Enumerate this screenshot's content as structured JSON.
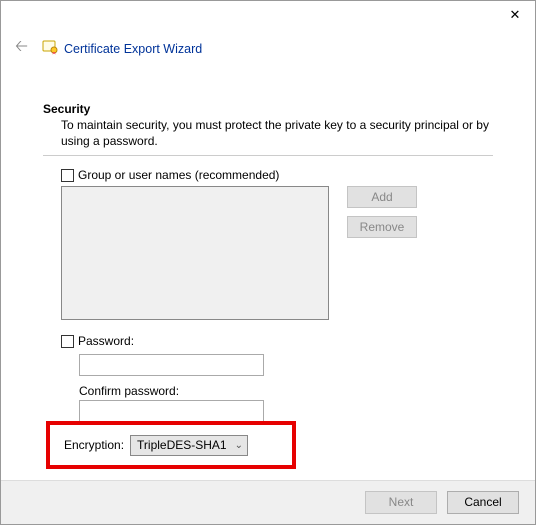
{
  "window": {
    "title": "Certificate Export Wizard"
  },
  "section": {
    "heading": "Security",
    "description": "To maintain security, you must protect the private key to a security principal or by using a password."
  },
  "form": {
    "group_label": "Group or user names (recommended)",
    "add_btn": "Add",
    "remove_btn": "Remove",
    "password_label": "Password:",
    "password_value": "",
    "confirm_label": "Confirm password:",
    "confirm_value": "",
    "encryption_label": "Encryption:",
    "encryption_value": "TripleDES-SHA1"
  },
  "footer": {
    "next": "Next",
    "cancel": "Cancel"
  }
}
